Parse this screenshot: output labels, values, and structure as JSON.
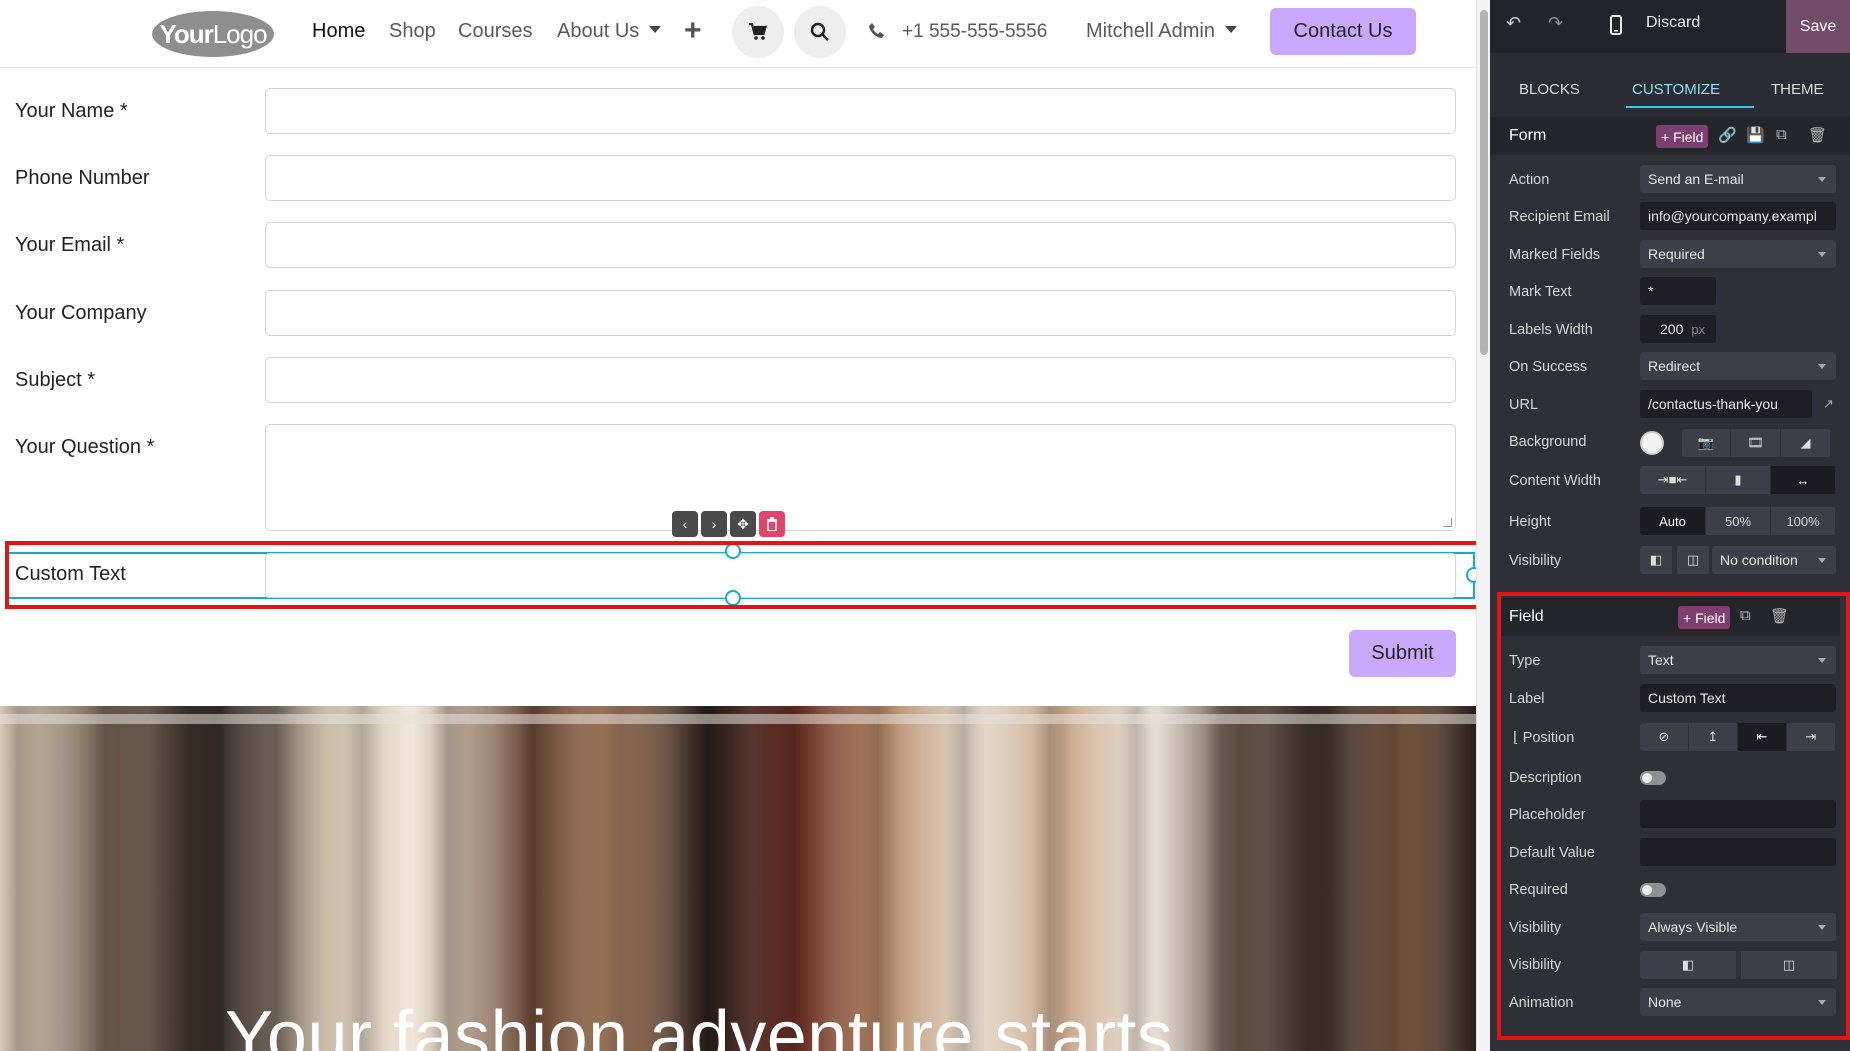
{
  "nav": {
    "logo_bold": "Your",
    "logo_light": "Logo",
    "items": [
      {
        "label": "Home"
      },
      {
        "label": "Shop"
      },
      {
        "label": "Courses"
      },
      {
        "label": "About Us"
      }
    ],
    "phone": "+1 555-555-5556",
    "user": "Mitchell Admin",
    "contact_button": "Contact Us"
  },
  "form": {
    "fields": [
      {
        "label": "Your Name *"
      },
      {
        "label": "Phone Number"
      },
      {
        "label": "Your Email *"
      },
      {
        "label": "Your Company"
      },
      {
        "label": "Subject *"
      },
      {
        "label": "Your Question *"
      }
    ],
    "custom_field_label": "Custom Text",
    "submit_label": "Submit"
  },
  "hero": {
    "title": "Your fashion adventure starts"
  },
  "editor": {
    "discard_label": "Discard",
    "save_label": "Save",
    "tabs": [
      {
        "label": "BLOCKS"
      },
      {
        "label": "CUSTOMIZE"
      },
      {
        "label": "THEME"
      }
    ],
    "active_tab": "CUSTOMIZE",
    "form_section": {
      "title": "Form",
      "add_field_label": "+ Field",
      "action_label": "Action",
      "action_value": "Send an E-mail",
      "recipient_label": "Recipient Email",
      "recipient_value": "info@yourcompany.exampl",
      "marked_label": "Marked Fields",
      "marked_value": "Required",
      "mark_text_label": "Mark Text",
      "mark_text_value": "*",
      "labels_width_label": "Labels Width",
      "labels_width_value": "200",
      "labels_width_unit": "px",
      "on_success_label": "On Success",
      "on_success_value": "Redirect",
      "url_label": "URL",
      "url_value": "/contactus-thank-you",
      "background_label": "Background",
      "content_width_label": "Content Width",
      "height_label": "Height",
      "height_options": [
        "Auto",
        "50%",
        "100%"
      ],
      "height_selected": "Auto",
      "visibility_label": "Visibility",
      "visibility_value": "No condition"
    },
    "field_section": {
      "title": "Field",
      "add_field_label": "+ Field",
      "type_label": "Type",
      "type_value": "Text",
      "label_label": "Label",
      "label_value": "Custom Text",
      "position_label": "Position",
      "description_label": "Description",
      "placeholder_label": "Placeholder",
      "placeholder_value": "",
      "default_label": "Default Value",
      "default_value": "",
      "required_label": "Required",
      "visibility_label": "Visibility",
      "visibility_value": "Always Visible",
      "visibility2_label": "Visibility",
      "animation_label": "Animation",
      "animation_value": "None"
    }
  }
}
